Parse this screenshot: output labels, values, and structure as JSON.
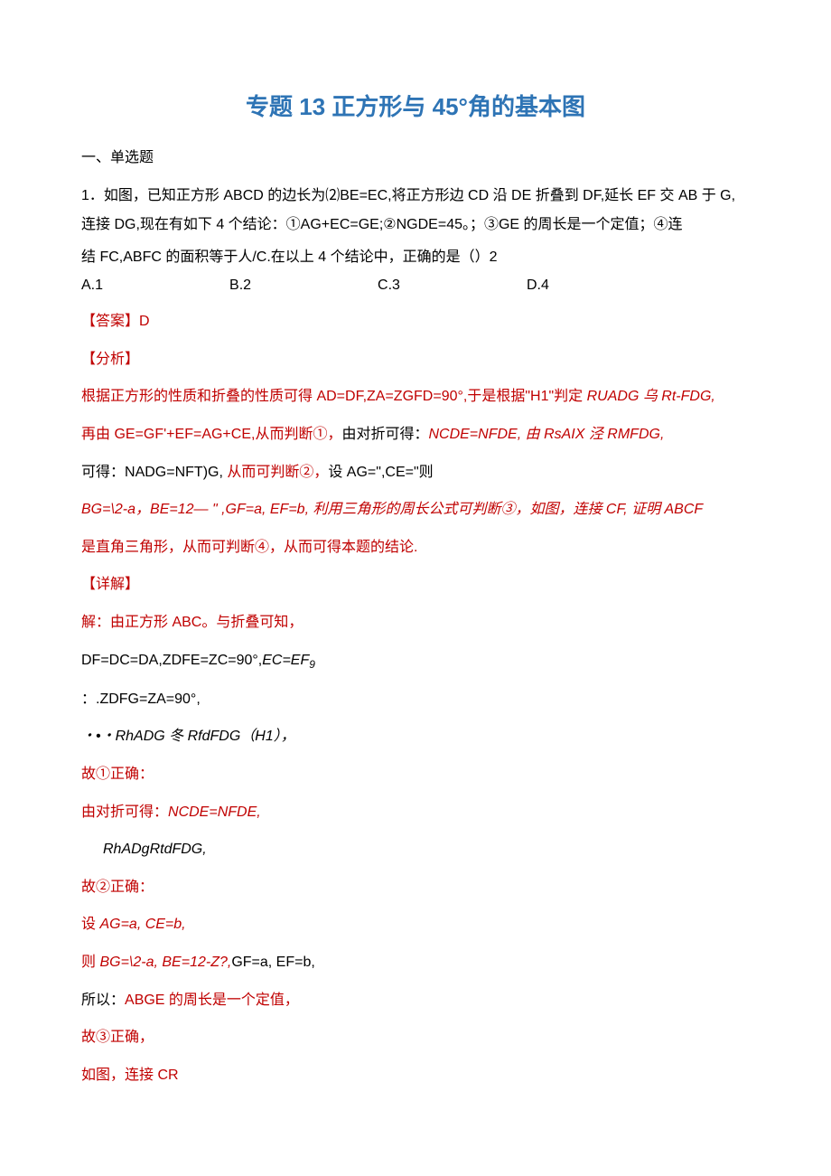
{
  "title": "专题 13 正方形与 45°角的基本图",
  "sectionHeading": "一、单选题",
  "question": {
    "line1": "1．如图，已知正方形 ABCD 的边长为⑵BE=EC,将正方形边 CD 沿 DE 折叠到 DF,延长 EF 交 AB 于 G,连接 DG,现在有如下 4 个结论：①AG+EC=GE;②NGDE=45。；③GE 的周长是一个定值；④连",
    "line2": "结 FC,ABFC 的面积等于人/C.在以上 4 个结论中，正确的是（）2",
    "choices": {
      "a": "A.1",
      "b": "B.2",
      "c": "C.3",
      "d": "D.4"
    }
  },
  "answerLabel": "【答案】",
  "answerVal": "D",
  "analysisHeader": "【分析】",
  "analysisLines": {
    "p1_a": "根据正方形的性质和折叠的性质可得 AD=DF,ZA=ZGFD=90°,于是根据\"H1\"判定 ",
    "p1_b": "RUADG 乌 Rt-FDG,",
    "p2_a": "再由 GE=GF'+EF=AG+CE,从而判断①，",
    "p2_b": "由对折可得：",
    "p2_c": "NCDE=NFDE,",
    "p2_d": " 由 ",
    "p2_e": "RsAIX 泾 RMFDG,",
    "p3_a": "可得：",
    "p3_b": "NADG=NFT)G,",
    "p3_c": " 从而可判断②，",
    "p3_d": "设 AG=\",CE=\"则",
    "p4": "BG=\\2-a，BE=12— \" ,GF=a, EF=b, 利用三角形的周长公式可判断③，如图，连接 CF, 证明 ABCF",
    "p5": "是直角三角形，从而可判断④，从而可得本题的结论."
  },
  "detailHeader": "【详解】",
  "detailLines": {
    "d1": "解：由正方形 ABC。与折叠可知，",
    "d2_a": "DF=DC=DA,ZDFE=ZC=90°,",
    "d2_b": "EC=EF",
    "d2_c": "9",
    "d3": "：.ZDFG=ZA=90°,",
    "d4": "・•・RhADG 冬 RfdFDG（H1），",
    "d5": "故①正确：",
    "d6_a": "由对折可得：",
    "d6_b": "NCDE=NFDE,",
    "d7": "RhADgRtdFDG,",
    "d8": "故②正确：",
    "d9_a": "设 ",
    "d9_b": "AG=a, CE=b,",
    "d10_a": "则 ",
    "d10_b": "BG=\\2-a, BE=12-Z?,",
    "d10_c": "GF=a, EF=b,",
    "d11_a": "所以：",
    "d11_b": "ABGE 的周长是一个定值，",
    "d12": "故③正确，",
    "d13": "如图，连接 CR"
  }
}
